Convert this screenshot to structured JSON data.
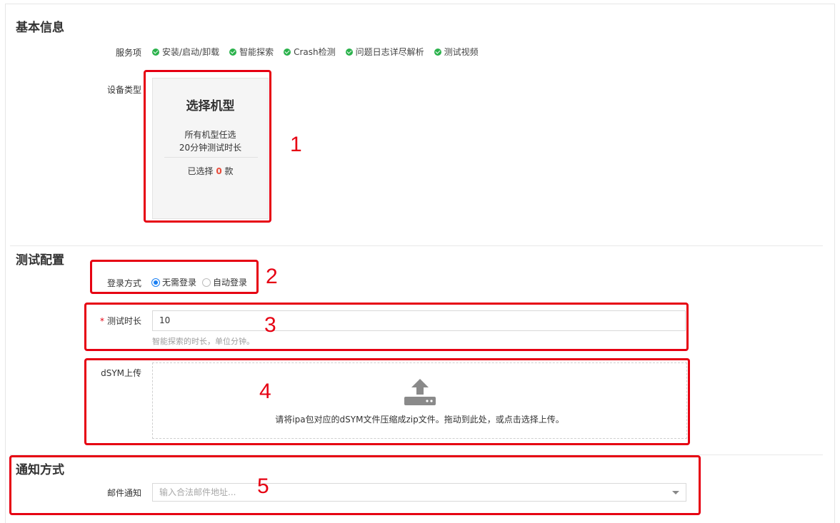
{
  "sections": {
    "basic": "基本信息",
    "config": "测试配置",
    "notify": "通知方式"
  },
  "basic": {
    "services_label": "服务项",
    "services": [
      "安装/启动/卸载",
      "智能探索",
      "Crash检测",
      "问题日志详尽解析",
      "测试视频"
    ],
    "device_label": "设备类型",
    "device_card": {
      "title": "选择机型",
      "line1": "所有机型任选",
      "line2": "20分钟测试时长",
      "selected_prefix": "已选择",
      "selected_count": "0",
      "selected_suffix": "款"
    }
  },
  "config": {
    "login_label": "登录方式",
    "login_options": [
      "无需登录",
      "自动登录"
    ],
    "login_selected": "无需登录",
    "duration_required_mark": "*",
    "duration_label": "测试时长",
    "duration_value": "10",
    "duration_hint": "智能探索的时长，单位分钟。",
    "dsym_label": "dSYM上传",
    "dsym_text": "请将ipa包对应的dSYM文件压缩成zip文件。拖动到此处，或点击选择上传。"
  },
  "notify": {
    "email_label": "邮件通知",
    "email_placeholder": "输入合法邮件地址..."
  },
  "annotations": [
    "1",
    "2",
    "3",
    "4",
    "5"
  ],
  "colors": {
    "annotation_red": "#e60012",
    "check_green": "#2bb24c",
    "radio_blue": "#1a7ff2",
    "count_red": "#e84b3a"
  },
  "icons": {
    "service_check": "check-circle-icon",
    "upload": "upload-icon",
    "select_arrow": "chevron-down-icon"
  }
}
